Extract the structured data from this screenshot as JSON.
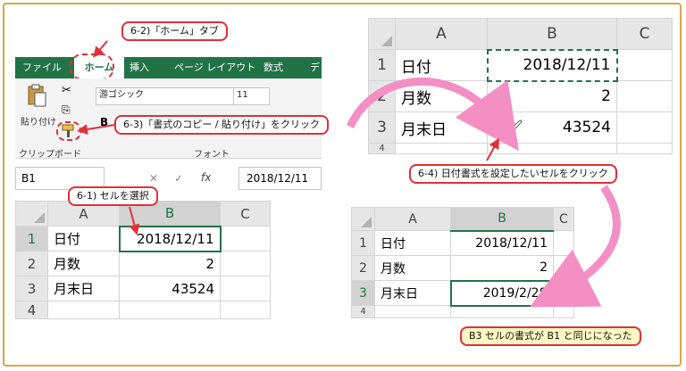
{
  "ribbon": {
    "tabs": [
      "ファイル",
      "ホーム",
      "挿入",
      "ページ レイアウト",
      "数式",
      "デ"
    ],
    "paste_label": "貼り付け",
    "clipboard_group": "クリップボード",
    "font_name": "游ゴシック",
    "font_size": "11",
    "font_group": "フォント",
    "bold": "B"
  },
  "formula_bar": {
    "name_box": "B1",
    "fx": "fx",
    "value": "2018/12/11"
  },
  "sheet_left": {
    "columns": [
      "A",
      "B",
      "C"
    ],
    "rows": [
      {
        "num": "1",
        "a": "日付",
        "b": "2018/12/11"
      },
      {
        "num": "2",
        "a": "月数",
        "b": "2"
      },
      {
        "num": "3",
        "a": "月末日",
        "b": "43524"
      },
      {
        "num": "4",
        "a": "",
        "b": ""
      }
    ]
  },
  "sheet_top_right": {
    "columns": [
      "A",
      "B",
      "C"
    ],
    "rows": [
      {
        "num": "1",
        "a": "日付",
        "b": "2018/12/11"
      },
      {
        "num": "2",
        "a": "月数",
        "b": "2"
      },
      {
        "num": "3",
        "a": "月末日",
        "b": "43524"
      },
      {
        "num": "4",
        "a": "",
        "b": ""
      }
    ]
  },
  "sheet_bottom_right": {
    "columns": [
      "A",
      "B",
      "C"
    ],
    "rows": [
      {
        "num": "1",
        "a": "日付",
        "b": "2018/12/11"
      },
      {
        "num": "2",
        "a": "月数",
        "b": "2"
      },
      {
        "num": "3",
        "a": "月末日",
        "b": "2019/2/28"
      },
      {
        "num": "4",
        "a": "",
        "b": ""
      }
    ]
  },
  "callouts": {
    "home_tab": "6-2)「ホーム」タブ",
    "format_painter": "6-3)「書式のコピー / 貼り付け」をクリック",
    "select_cell": "6-1) セルを選択",
    "click_target": "6-4) 日付書式を設定したいセルをクリック",
    "result": "B3 セルの書式が B1 と同じになった"
  },
  "colors": {
    "excel_green": "#217346",
    "callout_border": "#e0303a",
    "arrow_pink": "#f48fc4",
    "frame": "#d9a648"
  }
}
